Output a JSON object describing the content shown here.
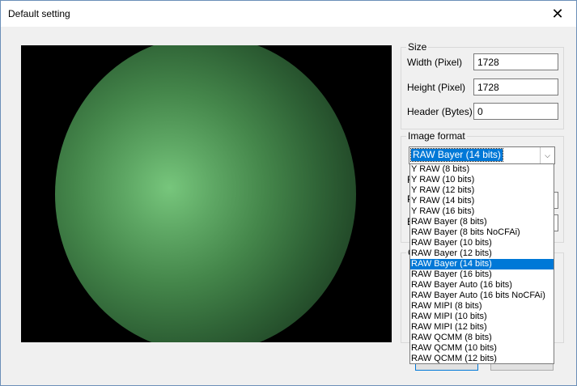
{
  "window": {
    "title": "Default setting",
    "close_glyph": "✕"
  },
  "size": {
    "group_label": "Size",
    "width_label": "Width (Pixel)",
    "width_value": "1728",
    "height_label": "Height (Pixel)",
    "height_value": "1728",
    "header_label": "Header (Bytes)",
    "header_value": "0"
  },
  "image_format": {
    "group_label": "Image format",
    "selected": "RAW Bayer (14 bits)",
    "options": [
      "Y RAW (8 bits)",
      "Y RAW (10 bits)",
      "Y RAW (12 bits)",
      "Y RAW (14 bits)",
      "Y RAW (16 bits)",
      "RAW Bayer (8 bits)",
      "RAW Bayer (8 bits NoCFAi)",
      "RAW Bayer (10 bits)",
      "RAW Bayer (12 bits)",
      "RAW Bayer (14 bits)",
      "RAW Bayer (16 bits)",
      "RAW Bayer Auto (16 bits)",
      "RAW Bayer Auto (16 bits NoCFAi)",
      "RAW MIPI (8 bits)",
      "RAW MIPI (10 bits)",
      "RAW MIPI (12 bits)",
      "RAW QCMM (8 bits)",
      "RAW QCMM (10 bits)",
      "RAW QCMM (12 bits)"
    ],
    "selected_index": 9
  },
  "partially_hidden": {
    "label_1": "R",
    "label_2": "P",
    "label_3": "B",
    "label_4": "C"
  },
  "colors": {
    "accent": "#0078d7",
    "preview_bg": "#000000",
    "preview_center": "#77c67c"
  },
  "icons": {
    "close": "close-icon",
    "dropdown_arrow": "chevron-down-icon"
  }
}
